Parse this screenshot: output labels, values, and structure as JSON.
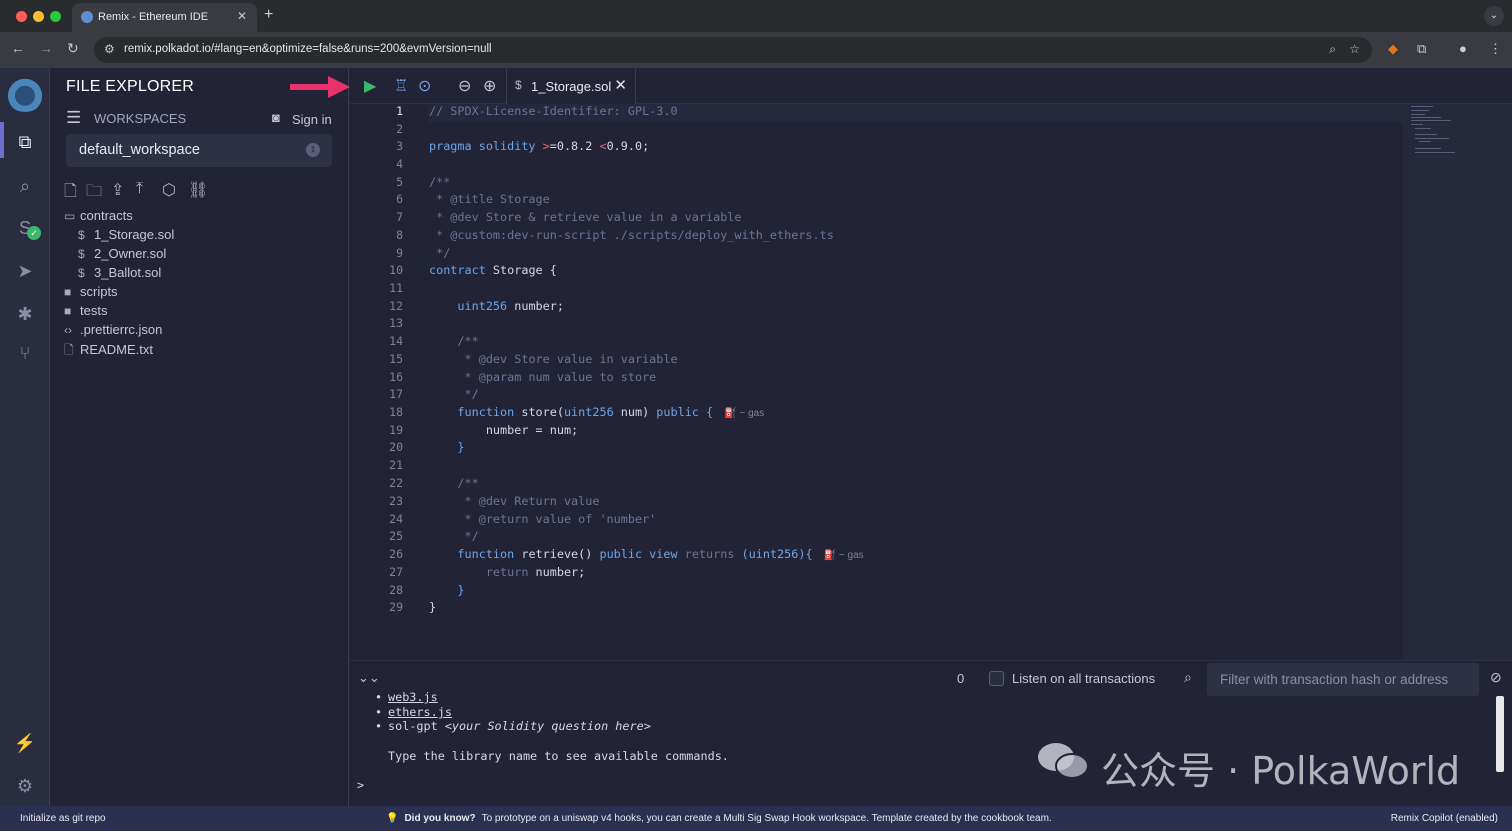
{
  "browser": {
    "tab_title": "Remix - Ethereum IDE",
    "url": "remix.polkadot.io/#lang=en&optimize=false&runs=200&evmVersion=null"
  },
  "explorer": {
    "title": "FILE EXPLORER",
    "workspaces_label": "WORKSPACES",
    "sign_in": "Sign in",
    "workspace": "default_workspace",
    "tree": [
      {
        "label": "contracts",
        "icon": "folder-open-icon",
        "level": 0
      },
      {
        "label": "1_Storage.sol",
        "icon": "solidity-file-icon",
        "level": 1
      },
      {
        "label": "2_Owner.sol",
        "icon": "solidity-file-icon",
        "level": 1
      },
      {
        "label": "3_Ballot.sol",
        "icon": "solidity-file-icon",
        "level": 1
      },
      {
        "label": "scripts",
        "icon": "folder-icon",
        "level": 0
      },
      {
        "label": "tests",
        "icon": "folder-icon",
        "level": 0
      },
      {
        "label": ".prettierrc.json",
        "icon": "json-file-icon",
        "level": 0
      },
      {
        "label": "README.txt",
        "icon": "text-file-icon",
        "level": 0
      }
    ]
  },
  "editor": {
    "active_file": "1_Storage.sol",
    "gas_label": "~ gas",
    "line_numbers": [
      "1",
      "2",
      "3",
      "4",
      "5",
      "6",
      "7",
      "8",
      "9",
      "10",
      "11",
      "12",
      "13",
      "14",
      "15",
      "16",
      "17",
      "18",
      "19",
      "20",
      "21",
      "22",
      "23",
      "24",
      "25",
      "26",
      "27",
      "28",
      "29"
    ],
    "code": {
      "l1": "// SPDX-License-Identifier: GPL-3.0",
      "l3_kw": "pragma solidity ",
      "l3_op1": ">",
      "l3_v1": "=0.8.2 ",
      "l3_op2": "<",
      "l3_v2": "0.9.0;",
      "l5": "/**",
      "l6": " * @title Storage",
      "l7": " * @dev Store & retrieve value in a variable",
      "l8": " * @custom:dev-run-script ./scripts/deploy_with_ethers.ts",
      "l9": " */",
      "l10_kw": "contract",
      "l10_rest": " Storage {",
      "l12_kw": "    uint256",
      "l12_rest": " number;",
      "l14": "    /**",
      "l15": "     * @dev Store value in variable",
      "l16": "     * @param num value to store",
      "l17": "     */",
      "l18_kw": "    function",
      "l18_a": " store(",
      "l18_kw2": "uint256",
      "l18_b": " num) ",
      "l18_kw3": "public",
      "l18_c": " {",
      "l19": "        number = num;",
      "l20": "    }",
      "l22": "    /**",
      "l23": "     * @dev Return value",
      "l24": "     * @return value of 'number'",
      "l25": "     */",
      "l26_kw": "    function",
      "l26_a": " retrieve() ",
      "l26_kw2": "public view",
      "l26_b": " returns ",
      "l26_c": "(uint256){",
      "l27_a": "        return",
      "l27_b": " number;",
      "l28": "    }",
      "l29": "}"
    }
  },
  "terminal_bar": {
    "count": "0",
    "listen_label": "Listen on all transactions",
    "filter_placeholder": "Filter with transaction hash or address"
  },
  "terminal": {
    "items": [
      "web3.js",
      "ethers.js"
    ],
    "gpt_cmd": "sol-gpt ",
    "gpt_hint": "<your Solidity question here>",
    "help": "Type the library name to see available commands.",
    "prompt": ">"
  },
  "watermark": {
    "text": "公众号 · PolkaWorld"
  },
  "statusbar": {
    "left": "Initialize as git repo",
    "did_you_know": "Did you know?",
    "tip": "To prototype on a uniswap v4 hooks, you can create a Multi Sig Swap Hook workspace. Template created by the cookbook team.",
    "right": "Remix Copilot (enabled)"
  },
  "colors": {
    "accent": "#6ea6e8",
    "run_button": "#3ab86b",
    "arrow": "#e8336a",
    "statusbar": "#2c3050"
  }
}
